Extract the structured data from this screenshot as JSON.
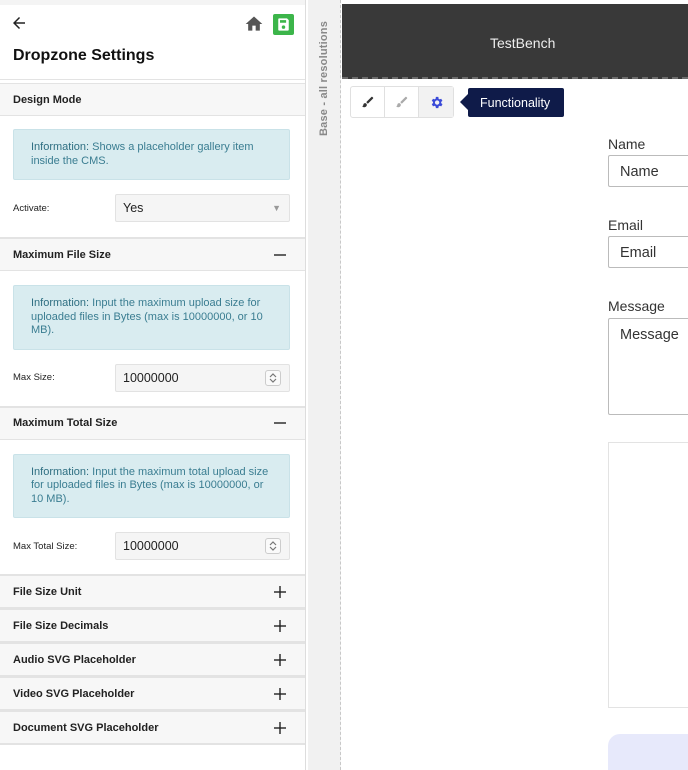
{
  "panel": {
    "title": "Dropzone Settings",
    "icons": {
      "back": "arrow-left-icon",
      "home": "home-icon",
      "save": "save-icon"
    },
    "save_color": "#3cb54a"
  },
  "sections": {
    "design_mode": {
      "title": "Design Mode",
      "info_label": "Information:",
      "info_text": " Shows a placeholder gallery item inside the CMS.",
      "field_label": "Activate:",
      "field_value": "Yes"
    },
    "max_file_size": {
      "title": "Maximum File Size",
      "info_label": "Information:",
      "info_text": " Input the maximum upload size for uploaded files in Bytes (max is 10000000, or 10 MB).",
      "field_label": "Max Size:",
      "field_value": "10000000"
    },
    "max_total_size": {
      "title": "Maximum Total Size",
      "info_label": "Information:",
      "info_text": " Input the maximum total upload size for uploaded files in Bytes (max is 10000000, or 10 MB).",
      "field_label": "Max Total Size:",
      "field_value": "10000000"
    },
    "collapsed": [
      {
        "title": "File Size Unit"
      },
      {
        "title": "File Size Decimals"
      },
      {
        "title": "Audio SVG Placeholder"
      },
      {
        "title": "Video SVG Placeholder"
      },
      {
        "title": "Document SVG Placeholder"
      }
    ]
  },
  "ruler": {
    "label": "Base - all resolutions"
  },
  "canvas": {
    "app_title": "TestBench",
    "header_color": "#393939",
    "tooltip": "Functionality",
    "tooltip_color": "#0f1b49",
    "tools": [
      "brush-icon",
      "brush-disabled-icon",
      "gear-icon"
    ],
    "form": {
      "name_label": "Name",
      "name_placeholder": "Name",
      "email_label": "Email",
      "email_placeholder": "Email",
      "message_label": "Message",
      "message_placeholder": "Message"
    }
  }
}
